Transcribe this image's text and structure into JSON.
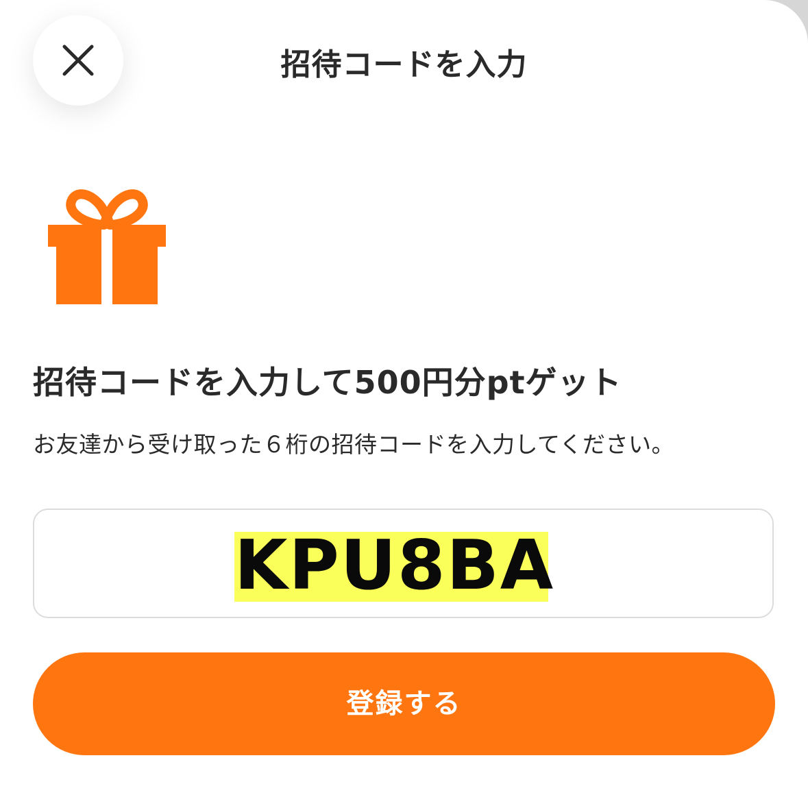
{
  "header": {
    "title": "招待コードを入力",
    "close_icon": "close-icon"
  },
  "gift": {
    "icon": "gift-icon",
    "color": "#FF7611"
  },
  "content": {
    "headline": "招待コードを入力して500円分ptゲット",
    "description": "お友達から受け取った６桁の招待コードを入力してください。"
  },
  "code_input": {
    "value": "KPU8BA",
    "highlight_color": "#FBFF5A"
  },
  "submit": {
    "label": "登録する",
    "color": "#FF7611"
  }
}
